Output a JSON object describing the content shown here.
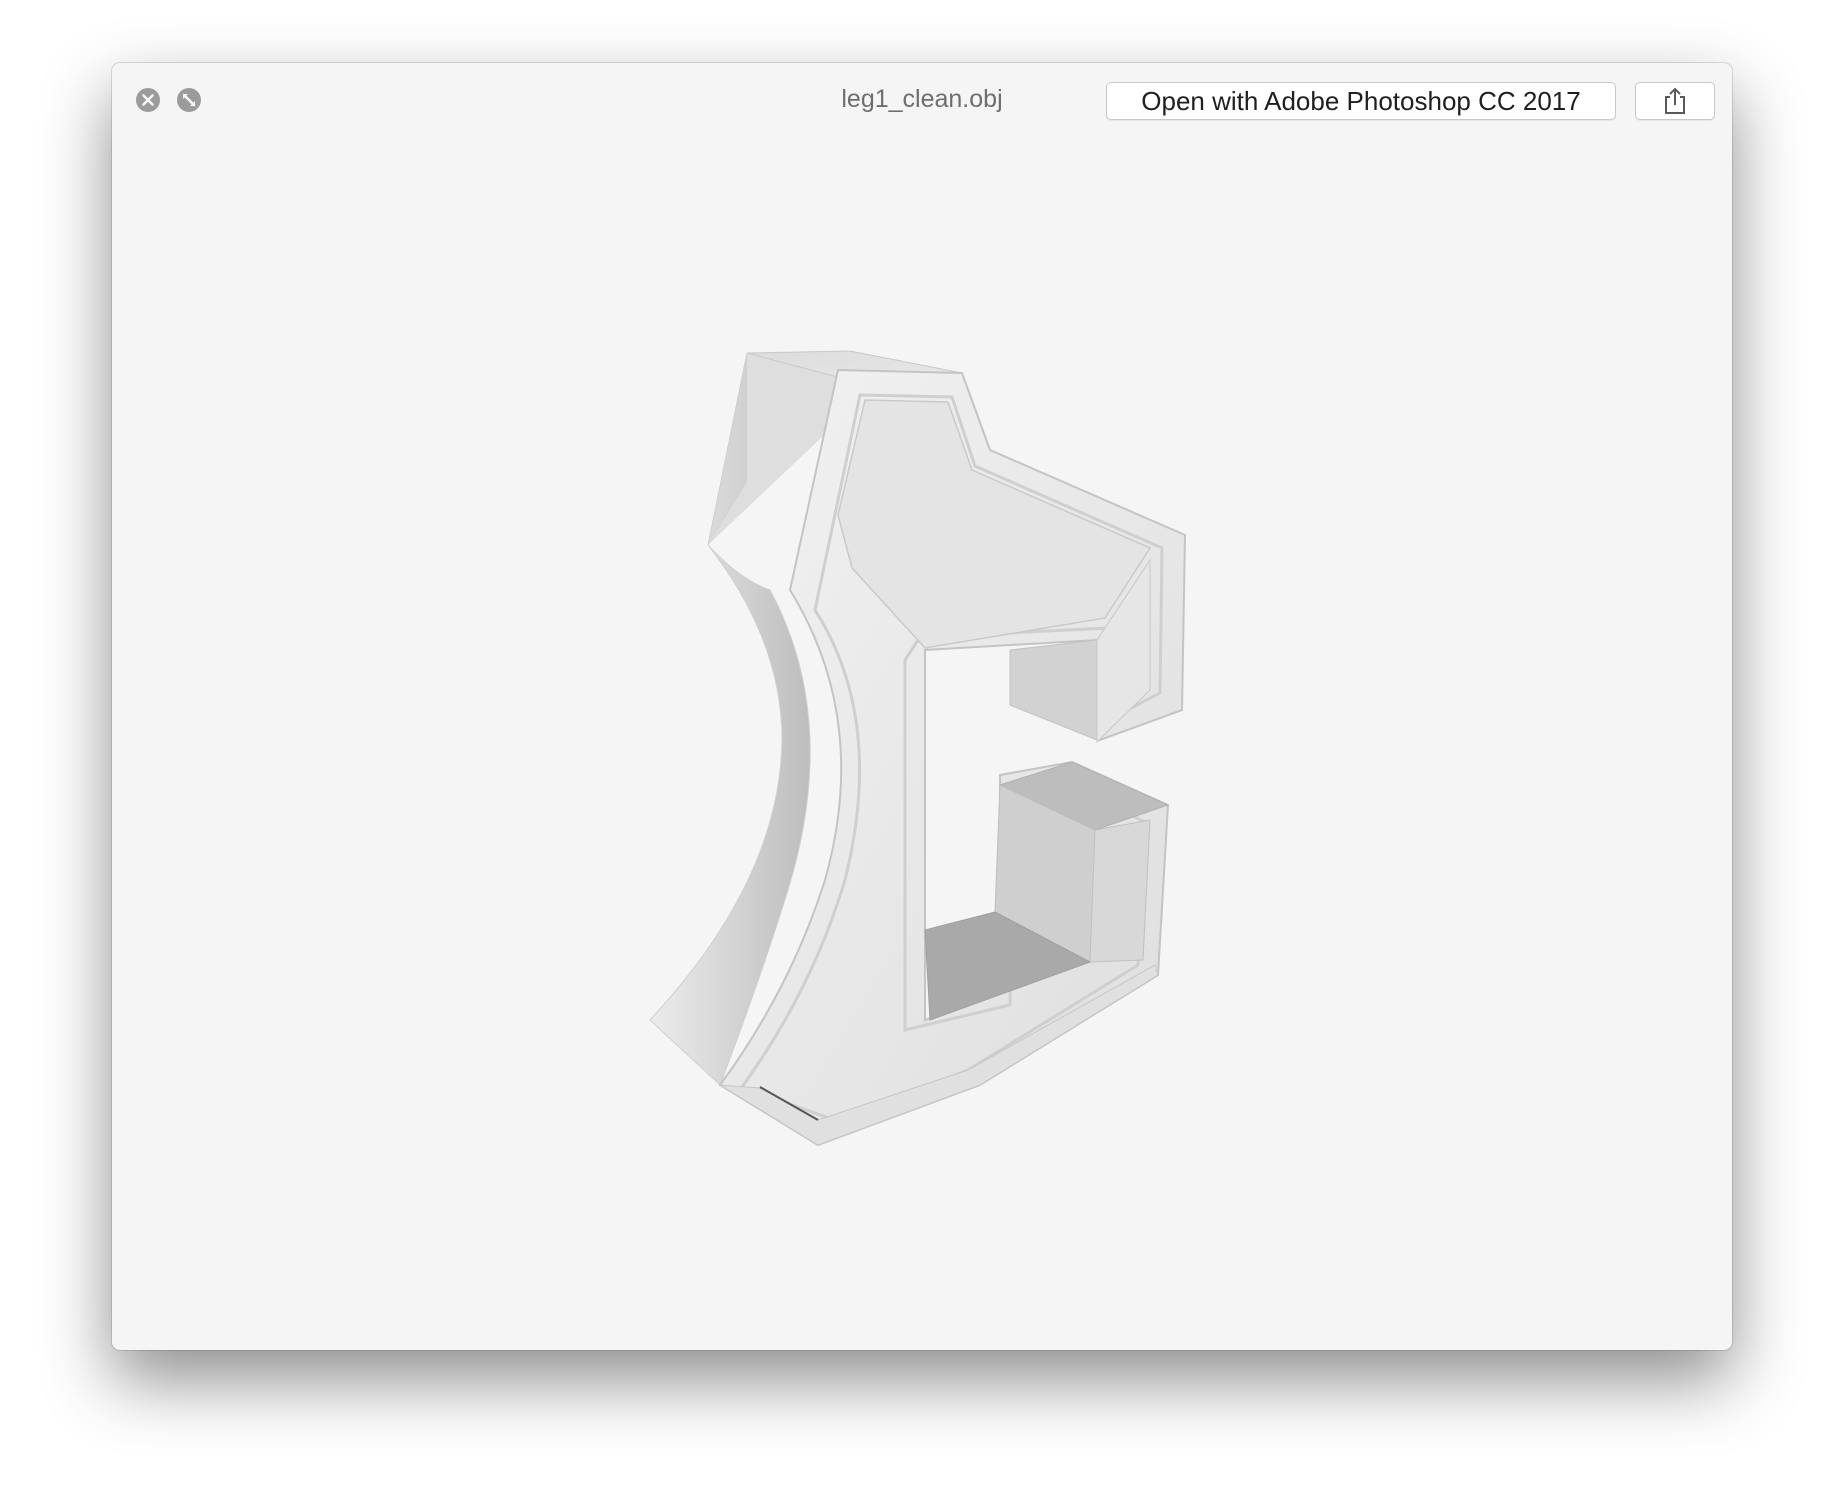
{
  "window": {
    "title": "leg1_clean.obj"
  },
  "toolbar": {
    "open_with_label": "Open with Adobe Photoshop CC 2017",
    "close_icon": "close-icon",
    "fullscreen_icon": "fullscreen-icon",
    "share_icon": "share-icon"
  },
  "viewport": {
    "content": "3d-model-render",
    "background_color": "#f5f5f5",
    "model_color": "#dcdcdc"
  }
}
